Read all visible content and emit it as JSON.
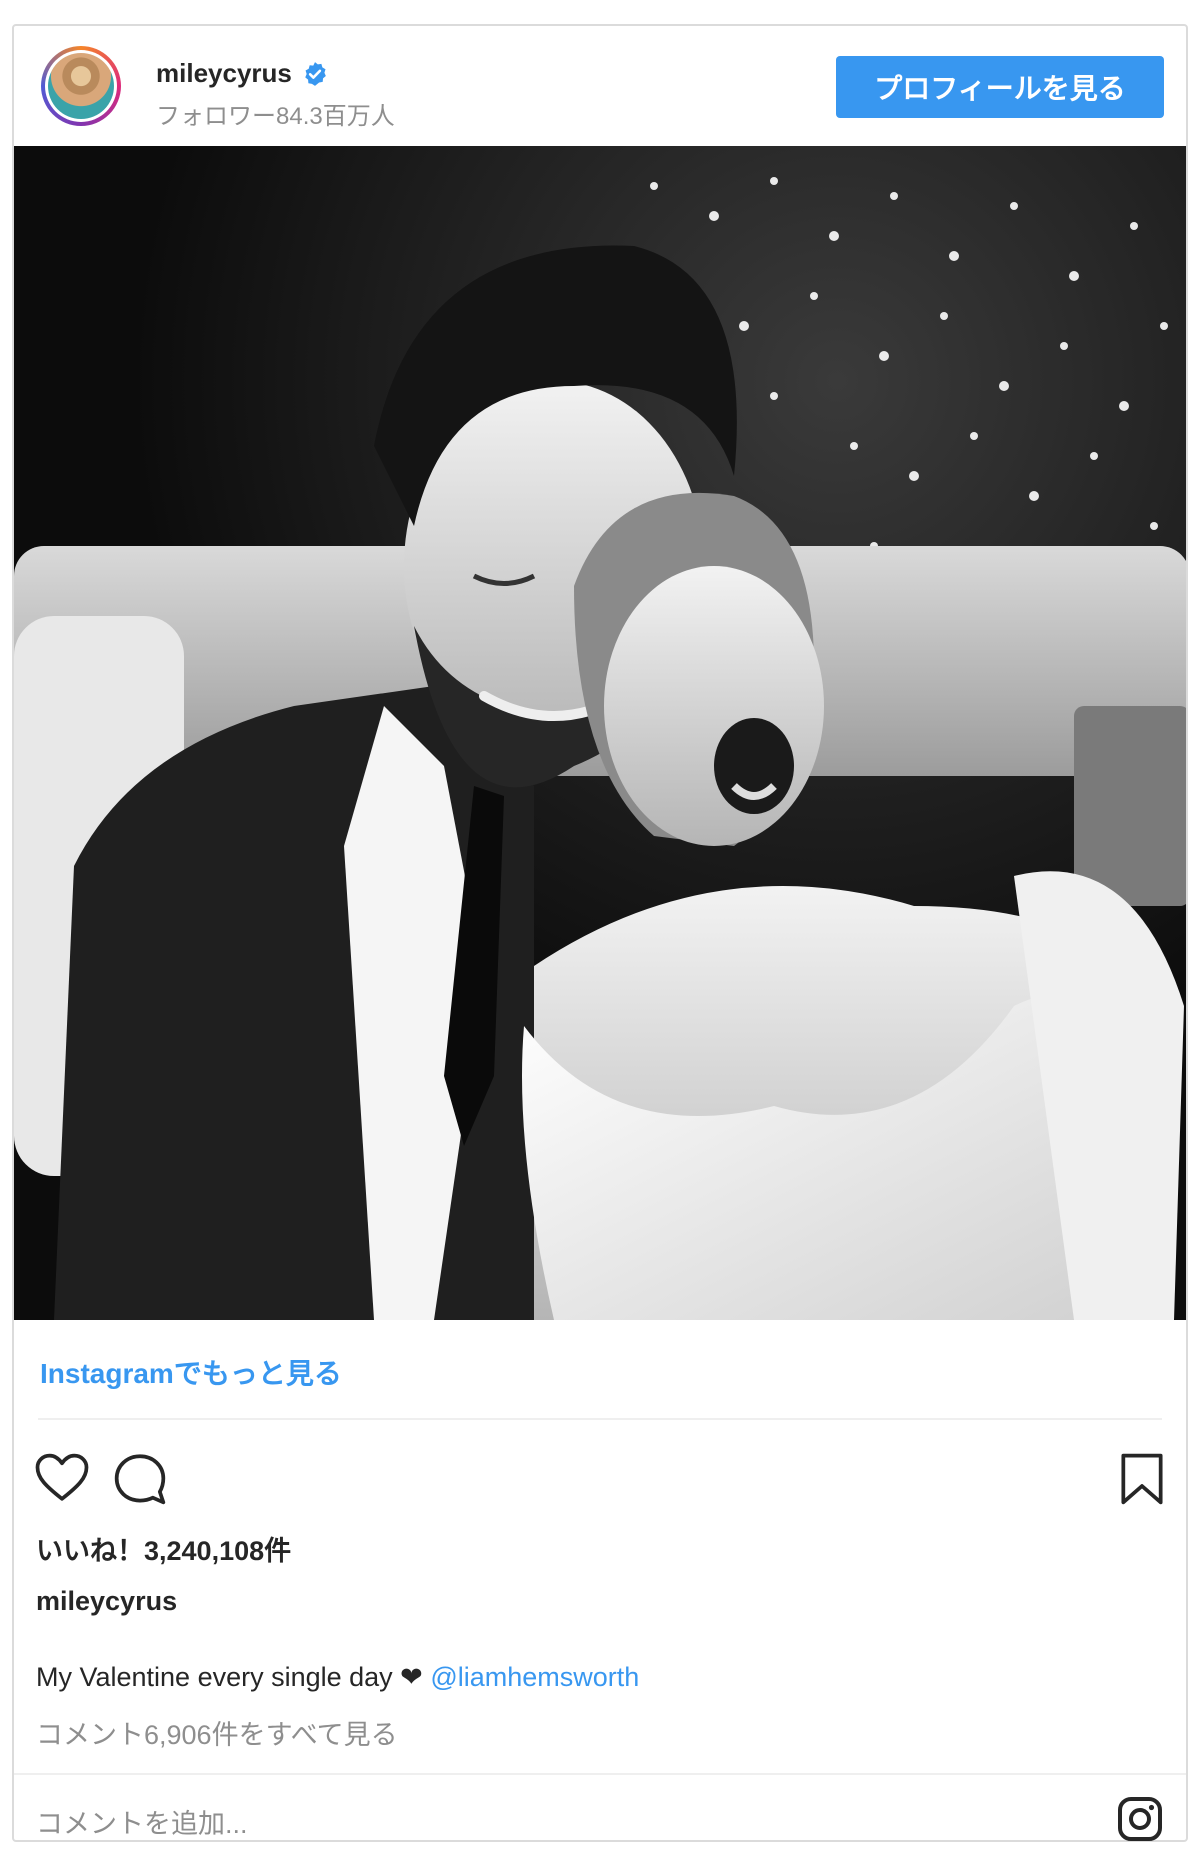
{
  "header": {
    "username": "mileycyrus",
    "followers": "フォロワー84.3百万人",
    "profile_button": "プロフィールを見る"
  },
  "photo": {
    "icon": "photo-black-white"
  },
  "more_link": "Instagramでもっと見る",
  "actions": {
    "like_icon": "heart-icon",
    "comment_icon": "comment-icon",
    "save_icon": "bookmark-icon"
  },
  "likes": "いいね！3,240,108件",
  "caption": {
    "username": "mileycyrus",
    "text": "My Valentine every single day ❤",
    "mention": "@liamhemsworth"
  },
  "view_comments": "コメント6,906件をすべて見る",
  "add_comment_placeholder": "コメントを追加...",
  "colors": {
    "accent": "#3897f0",
    "muted": "#8e8e8e",
    "text": "#262626",
    "border": "#dbdbdb"
  }
}
